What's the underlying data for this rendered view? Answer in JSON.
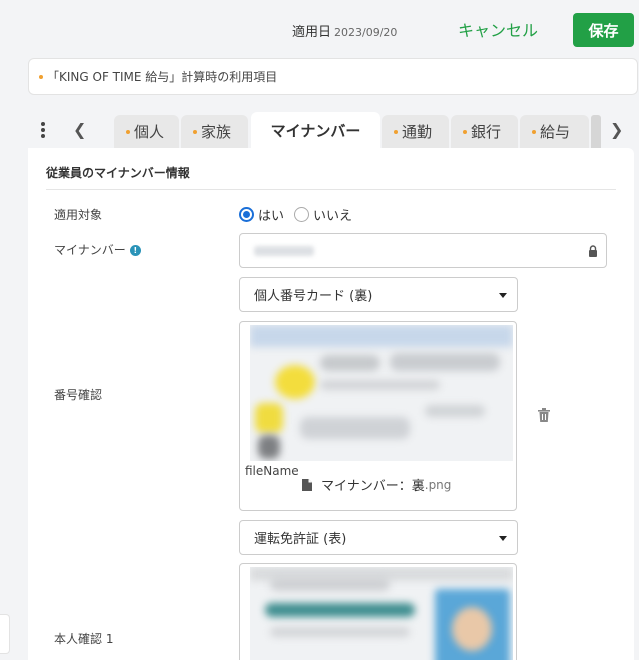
{
  "header": {
    "date_label": "適用日",
    "date_value": "2023/09/20",
    "cancel_label": "キャンセル",
    "save_label": "保存"
  },
  "notice": {
    "text": "「KING OF TIME 給与」計算時の利用項目"
  },
  "tabs": [
    {
      "label": "個人",
      "active": false
    },
    {
      "label": "家族",
      "active": false
    },
    {
      "label": "マイナンバー",
      "active": true
    },
    {
      "label": "通勤",
      "active": false
    },
    {
      "label": "銀行",
      "active": false
    },
    {
      "label": "給与",
      "active": false
    }
  ],
  "section": {
    "title": "従業員のマイナンバー情報"
  },
  "fields": {
    "applicable_label": "適用対象",
    "radio_yes": "はい",
    "radio_no": "いいえ",
    "radio_selected": "はい",
    "mynumber_label": "マイナンバー",
    "number_check_label": "番号確認",
    "number_check_doc": "個人番号カード (裏)",
    "file_caption": "fileName",
    "file_name": "マイナンバー：裏",
    "file_ext": ".png",
    "identity_label": "本人確認 1",
    "identity_doc": "運転免許証 (表)"
  },
  "colors": {
    "accent_green": "#22a046",
    "radio_blue": "#1a6fd8",
    "info_teal": "#2a93b8",
    "tab_dot": "#f0a030"
  }
}
